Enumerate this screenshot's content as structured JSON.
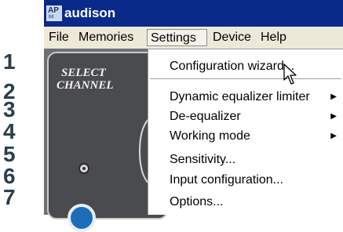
{
  "steps": [
    "1",
    "2",
    "3",
    "4",
    "5",
    "6",
    "7"
  ],
  "window": {
    "title": "audison",
    "icon_text": "AP",
    "icon_subtext": "bit"
  },
  "menubar": {
    "items": [
      "File",
      "Memories",
      "Settings",
      "Device",
      "Help"
    ],
    "active": "Settings"
  },
  "panel": {
    "select_label": "SELECT",
    "channel_label": "CHANNEL"
  },
  "dropdown": {
    "items": [
      {
        "label": "Configuration wizard...",
        "submenu": false
      },
      {
        "label": "Dynamic equalizer limiter",
        "submenu": true
      },
      {
        "label": "De-equalizer",
        "submenu": true
      },
      {
        "label": "Working mode",
        "submenu": true
      },
      {
        "label": "Sensitivity...",
        "submenu": false
      },
      {
        "label": "Input configuration...",
        "submenu": false
      },
      {
        "label": "Options...",
        "submenu": false
      }
    ],
    "submenu_arrow": "▶"
  },
  "colors": {
    "titlebar": "#0a2a8a",
    "menubar": "#ece9d8",
    "step_numbers": "#2a3f4c"
  },
  "icons": [
    "app-icon",
    "submenu-arrow-icon",
    "mouse-pointer-icon"
  ]
}
